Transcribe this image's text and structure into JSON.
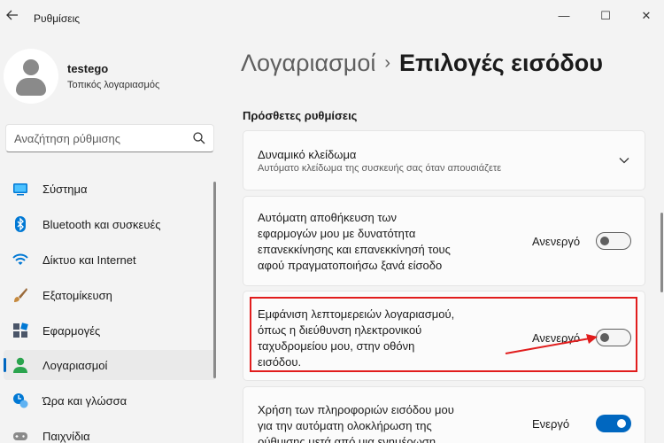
{
  "window": {
    "title": "Ρυθμίσεις",
    "back_icon": "back-arrow-icon",
    "minimize_glyph": "—",
    "maximize_glyph": "☐",
    "close_glyph": "✕"
  },
  "profile": {
    "name": "testego",
    "account_type": "Τοπικός λογαριασμός"
  },
  "search": {
    "placeholder": "Αναζήτηση ρύθμισης"
  },
  "sidebar": {
    "items": [
      {
        "label": "Σύστημα",
        "icon": "system-icon",
        "color": "#0078d4"
      },
      {
        "label": "Bluetooth και συσκευές",
        "icon": "bluetooth-icon",
        "color": "#0078d4"
      },
      {
        "label": "Δίκτυο και Internet",
        "icon": "wifi-icon",
        "color": "#0078d4"
      },
      {
        "label": "Εξατομίκευση",
        "icon": "brush-icon",
        "color": "#c68a3e"
      },
      {
        "label": "Εφαρμογές",
        "icon": "apps-icon",
        "color": "#4a5568"
      },
      {
        "label": "Λογαριασμοί",
        "icon": "account-icon",
        "color": "#2ba44e",
        "active": true
      },
      {
        "label": "Ώρα και γλώσσα",
        "icon": "clock-globe-icon",
        "color": "#0078d4"
      },
      {
        "label": "Παιχνίδια",
        "icon": "gamepad-icon",
        "color": "#8a8a8a"
      }
    ]
  },
  "header": {
    "parent": "Λογαριασμοί",
    "separator": "›",
    "current": "Επιλογές εισόδου"
  },
  "section": {
    "title": "Πρόσθετες ρυθμίσεις"
  },
  "settings": [
    {
      "title": "Δυναμικό κλείδωμα",
      "subtitle": "Αυτόματο κλείδωμα της συσκευής σας όταν απουσιάζετε",
      "control": "expand"
    },
    {
      "lines": [
        "Αυτόματη αποθήκευση των",
        "εφαρμογών μου με δυνατότητα",
        "επανεκκίνησης και επανεκκίνησή τους",
        "αφού πραγματοποιήσω ξανά είσοδο"
      ],
      "state": "Ανενεργό",
      "on": false
    },
    {
      "lines": [
        "Εμφάνιση λεπτομερειών λογαριασμού,",
        "όπως η διεύθυνση ηλεκτρονικού",
        "ταχυδρομείου μου, στην οθόνη",
        "εισόδου."
      ],
      "state": "Ανενεργό",
      "on": false,
      "highlighted": true
    },
    {
      "lines": [
        "Χρήση των πληροφοριών εισόδου μου",
        "για την αυτόματη ολοκλήρωση της",
        "ρύθμισης μετά από μια ενημέρωση"
      ],
      "state": "Ενεργό",
      "on": true
    }
  ],
  "colors": {
    "accent": "#0067c0",
    "highlight": "#e11d1d",
    "background": "#f3f3f3",
    "card": "#fbfbfb"
  }
}
